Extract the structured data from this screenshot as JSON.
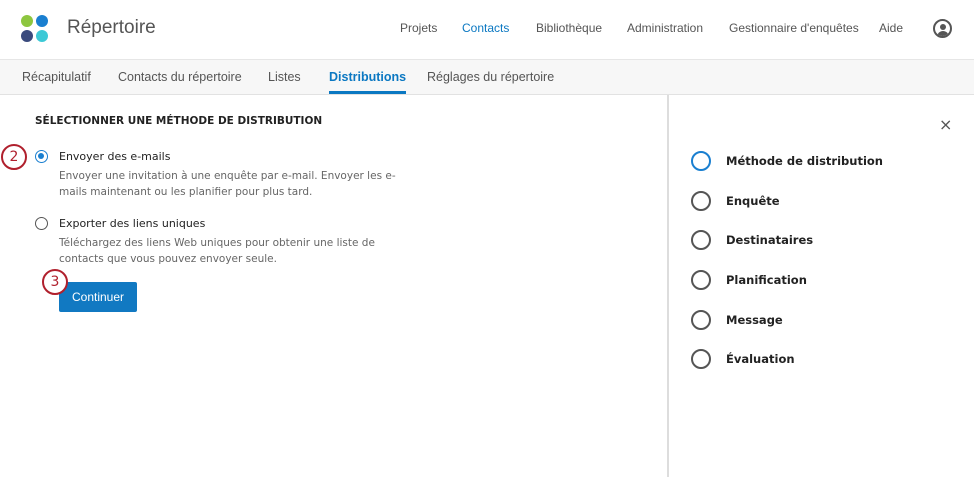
{
  "header": {
    "title": "Répertoire",
    "nav": [
      "Projets",
      "Contacts",
      "Bibliothèque",
      "Administration",
      "Gestionnaire d'enquêtes",
      "Aide"
    ],
    "active_nav": "Contacts",
    "logo_colors": [
      "#8dc63f",
      "#1a7fd0",
      "#3a4a7d",
      "#3cc9d6"
    ]
  },
  "tabs": {
    "items": [
      "Récapitulatif",
      "Contacts du répertoire",
      "Listes",
      "Distributions",
      "Réglages du répertoire"
    ],
    "active": "Distributions"
  },
  "main": {
    "section_title": "SÉLECTIONNER UNE MÉTHODE DE DISTRIBUTION",
    "options": [
      {
        "label": "Envoyer des e-mails",
        "desc": "Envoyer une invitation à une enquête par e-mail. Envoyer les e-mails maintenant ou les planifier pour plus tard.",
        "selected": true
      },
      {
        "label": "Exporter des liens uniques",
        "desc": "Téléchargez des liens Web uniques pour obtenir une liste de contacts que vous pouvez envoyer seule.",
        "selected": false
      }
    ],
    "continue_label": "Continuer",
    "badges": [
      "2",
      "3"
    ]
  },
  "panel": {
    "close_icon": "×",
    "steps": [
      "Méthode de distribution",
      "Enquête",
      "Destinataires",
      "Planification",
      "Message",
      "Évaluation"
    ],
    "current_step": 0
  },
  "colors": {
    "accent": "#0b78c2",
    "badge": "#b0202d"
  }
}
